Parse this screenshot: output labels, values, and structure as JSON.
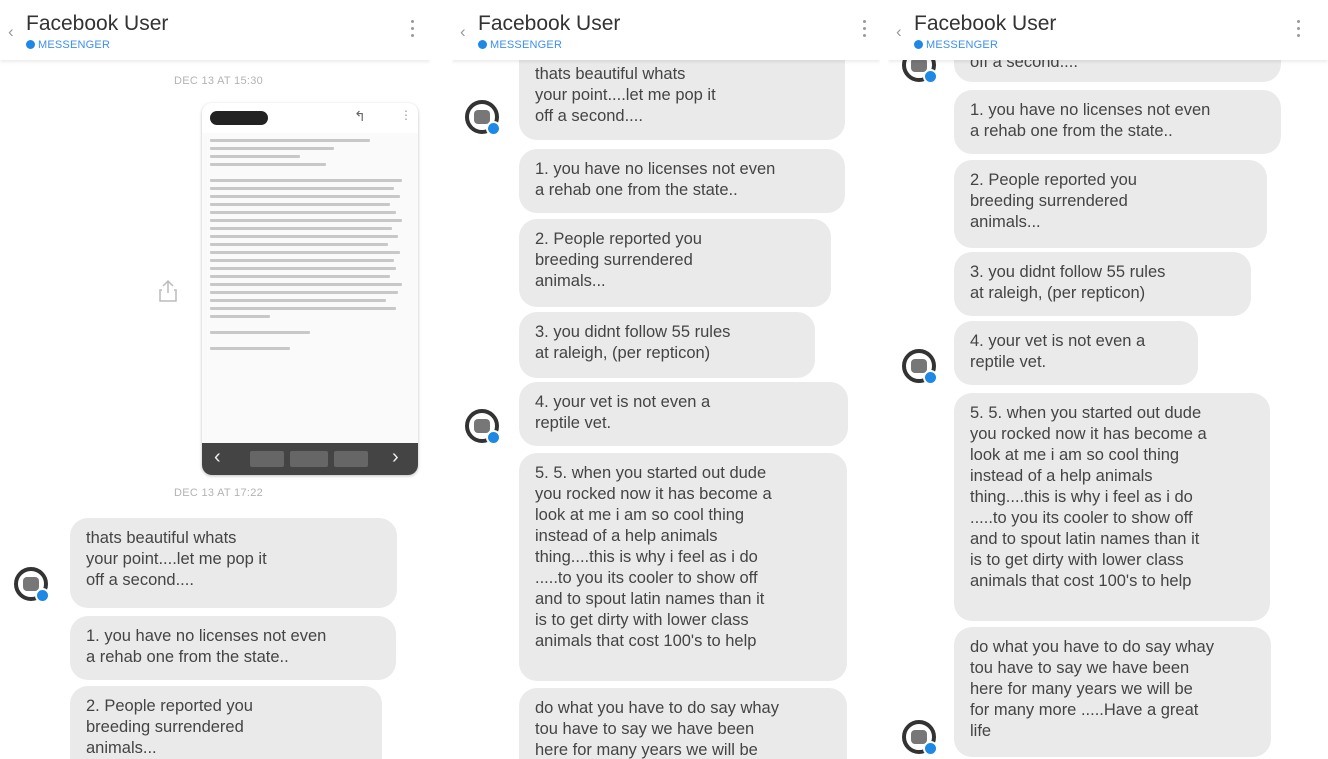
{
  "header": {
    "title": "Facebook User",
    "subtitle": "MESSENGER"
  },
  "panel1": {
    "timestamp1": "DEC 13 AT 15:30",
    "timestamp2": "DEC 13 AT 17:22",
    "messages": [
      "thats beautiful whats\nyour point....let me pop it\noff a second....",
      "1. you have no licenses not even\na rehab one from the state..",
      "2. People reported you\nbreeding surrendered\nanimals..."
    ]
  },
  "panel2": {
    "messages": [
      "thats beautiful whats\nyour point....let me pop it\noff a second....",
      "1. you have no licenses not even\na rehab one from the state..",
      "2. People reported you\nbreeding surrendered\nanimals...",
      "3. you didnt follow 55 rules\nat raleigh, (per repticon)",
      "4. your vet is not even a\nreptile vet.",
      "5. 5. when you started out dude\nyou rocked now it has become a\nlook at me i am so cool thing\ninstead of a help animals\nthing....this is why i feel as i do\n.....to you its cooler to show off\nand to spout latin names than it\nis to get dirty with lower class\nanimals that cost 100's to help",
      "do what you have to do say whay\ntou have to say we have been\nhere for many years we will be"
    ]
  },
  "panel3": {
    "messages": [
      "off a second....",
      "1. you have no licenses not even\na rehab one from the state..",
      "2. People reported you\nbreeding surrendered\nanimals...",
      "3. you didnt follow 55 rules\nat raleigh, (per repticon)",
      "4. your vet is not even a\nreptile vet.",
      "5. 5. when you started out dude\nyou rocked now it has become a\nlook at me i am so cool thing\ninstead of a help animals\nthing....this is why i feel as i do\n.....to you its cooler to show off\nand to spout latin names than it\nis to get dirty with lower class\nanimals that cost 100's to help",
      "do what you have to do say whay\ntou have to say we have been\nhere for many years we will be\nfor many more .....Have a great\nlife"
    ]
  },
  "icons": {
    "back": "chevron-left-icon",
    "menu": "kebab-menu-icon",
    "share": "share-icon",
    "avatar": "avatar-icon"
  },
  "colors": {
    "accent": "#1e88e5",
    "bubble": "#eaeaea"
  }
}
